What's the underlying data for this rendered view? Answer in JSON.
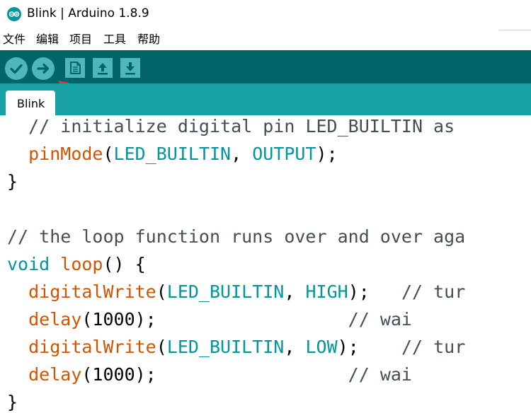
{
  "window": {
    "title": "Blink | Arduino 1.8.9"
  },
  "menu": {
    "items": [
      "文件",
      "编辑",
      "项目",
      "工具",
      "帮助"
    ]
  },
  "toolbar": {
    "buttons": [
      "verify",
      "upload",
      "new",
      "open",
      "save"
    ]
  },
  "tabs": [
    {
      "label": "Blink"
    }
  ],
  "colors": {
    "toolbar_bg": "#006468",
    "tabbar_bg": "#17a1a5",
    "button": "#4db7bb",
    "function": "#d35400",
    "keyword": "#00979c",
    "arrow": "#e53935"
  },
  "icons": [
    "arduino-logo-icon",
    "checkmark-icon",
    "arrow-right-icon",
    "document-icon",
    "upload-arrow-icon",
    "download-arrow-icon",
    "red-arrow-icon"
  ],
  "code": {
    "lines": [
      {
        "indent": "  ",
        "tokens": [
          {
            "t": "// initialize digital pin LED_BUILTIN as",
            "c": "comment"
          }
        ]
      },
      {
        "indent": "  ",
        "tokens": [
          {
            "t": "pinMode",
            "c": "fn"
          },
          {
            "t": "(",
            "c": ""
          },
          {
            "t": "LED_BUILTIN",
            "c": "kw"
          },
          {
            "t": ", ",
            "c": ""
          },
          {
            "t": "OUTPUT",
            "c": "kw"
          },
          {
            "t": ");",
            "c": ""
          }
        ]
      },
      {
        "indent": "",
        "tokens": [
          {
            "t": "}",
            "c": ""
          }
        ]
      },
      {
        "indent": "",
        "tokens": []
      },
      {
        "indent": "",
        "tokens": [
          {
            "t": "// the loop function runs over and over aga",
            "c": "comment"
          }
        ]
      },
      {
        "indent": "",
        "tokens": [
          {
            "t": "void",
            "c": "ty"
          },
          {
            "t": " ",
            "c": ""
          },
          {
            "t": "loop",
            "c": "fn"
          },
          {
            "t": "() {",
            "c": ""
          }
        ]
      },
      {
        "indent": "  ",
        "tokens": [
          {
            "t": "digitalWrite",
            "c": "fn"
          },
          {
            "t": "(",
            "c": ""
          },
          {
            "t": "LED_BUILTIN",
            "c": "kw"
          },
          {
            "t": ", ",
            "c": ""
          },
          {
            "t": "HIGH",
            "c": "kw"
          },
          {
            "t": ");   ",
            "c": ""
          },
          {
            "t": "// tur",
            "c": "comment"
          }
        ]
      },
      {
        "indent": "  ",
        "tokens": [
          {
            "t": "delay",
            "c": "fn"
          },
          {
            "t": "(1000);                  ",
            "c": ""
          },
          {
            "t": "// wai",
            "c": "comment"
          }
        ]
      },
      {
        "indent": "  ",
        "tokens": [
          {
            "t": "digitalWrite",
            "c": "fn"
          },
          {
            "t": "(",
            "c": ""
          },
          {
            "t": "LED_BUILTIN",
            "c": "kw"
          },
          {
            "t": ", ",
            "c": ""
          },
          {
            "t": "LOW",
            "c": "kw"
          },
          {
            "t": ");    ",
            "c": ""
          },
          {
            "t": "// tur",
            "c": "comment"
          }
        ]
      },
      {
        "indent": "  ",
        "tokens": [
          {
            "t": "delay",
            "c": "fn"
          },
          {
            "t": "(1000);                  ",
            "c": ""
          },
          {
            "t": "// wai",
            "c": "comment"
          }
        ]
      },
      {
        "indent": "",
        "tokens": [
          {
            "t": "}",
            "c": ""
          }
        ]
      }
    ]
  }
}
